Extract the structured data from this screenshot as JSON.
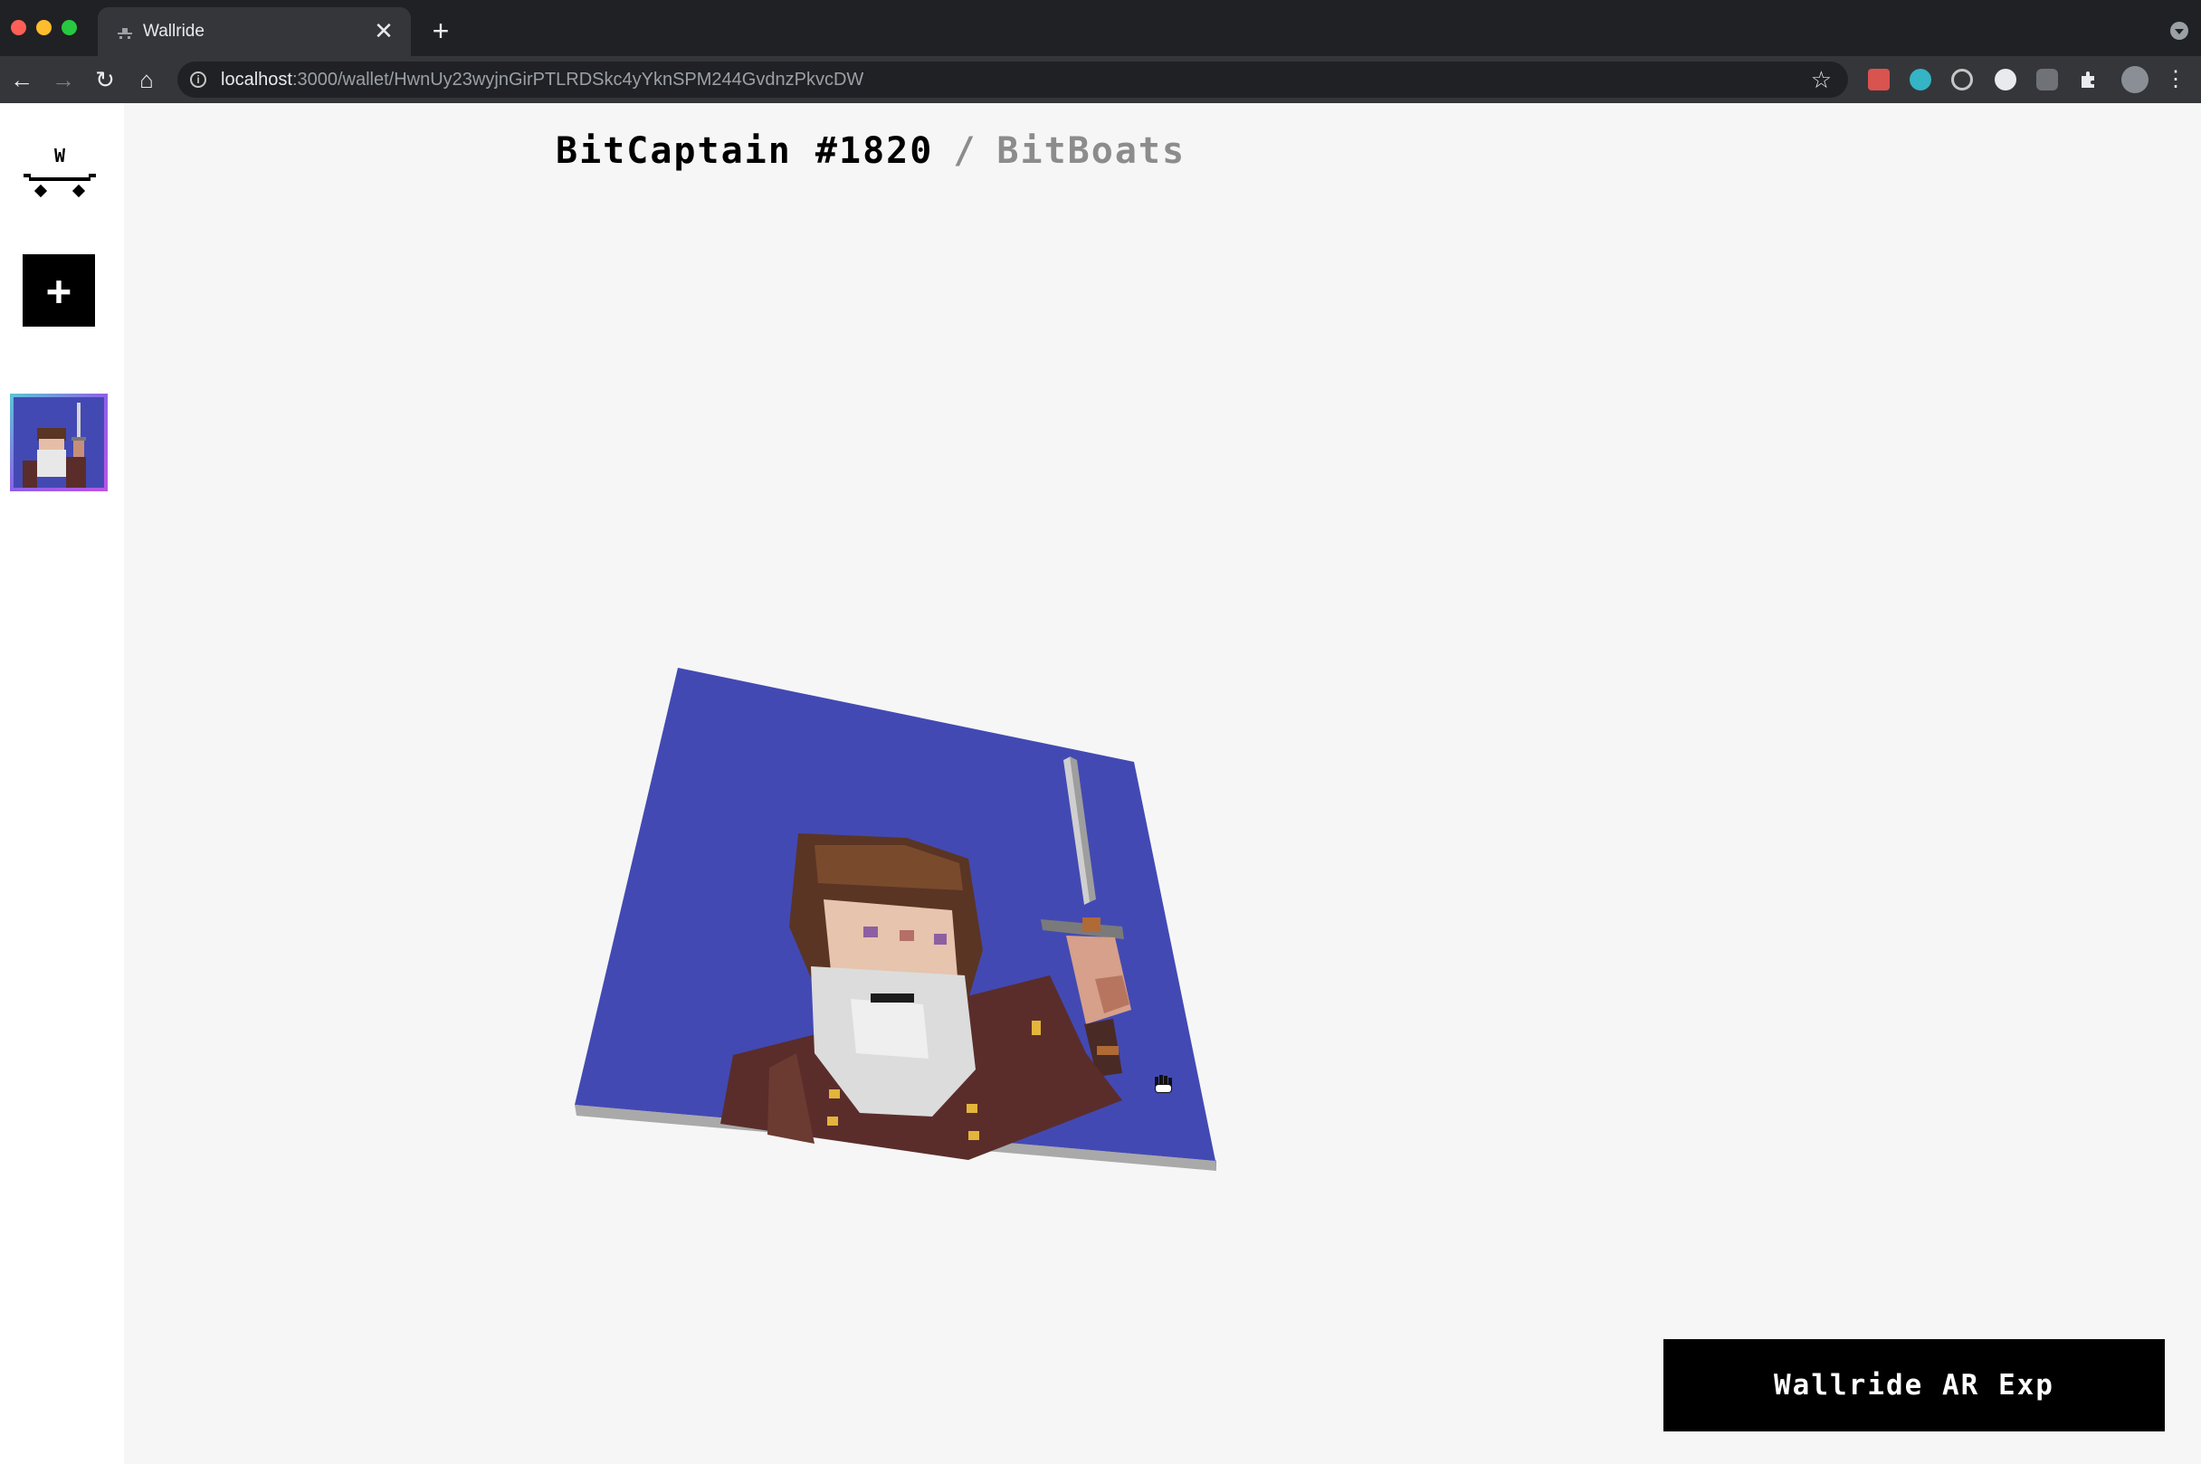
{
  "browser": {
    "tab_title": "Wallride",
    "tab_close": "✕",
    "new_tab": "+",
    "url_host": "localhost",
    "url_path": ":3000/wallet/HwnUy23wyjnGirPTLRDSkc4yYknSPM244GvdnzPkvcDW",
    "info_glyph": "i",
    "star": "☆",
    "nav": {
      "back": "←",
      "forward": "→",
      "reload": "↻",
      "home": "⌂"
    },
    "extensions": [
      "red-extension-icon",
      "m-extension-icon",
      "target-extension-icon",
      "lastpass-extension-icon",
      "shield-extension-icon",
      "puzzle-extension-icon",
      "profile-avatar"
    ]
  },
  "sidebar": {
    "add_label": "+",
    "logo_text": "W"
  },
  "nft": {
    "name": "BitCaptain #1820",
    "separator": "/",
    "collection": "BitBoats"
  },
  "ar_button": {
    "label": "Wallride AR Exp"
  },
  "colors": {
    "background": "#f6f6f6",
    "art_background": "#4349b3",
    "button_black": "#000000",
    "heading_gray": "#8c8c8c"
  }
}
